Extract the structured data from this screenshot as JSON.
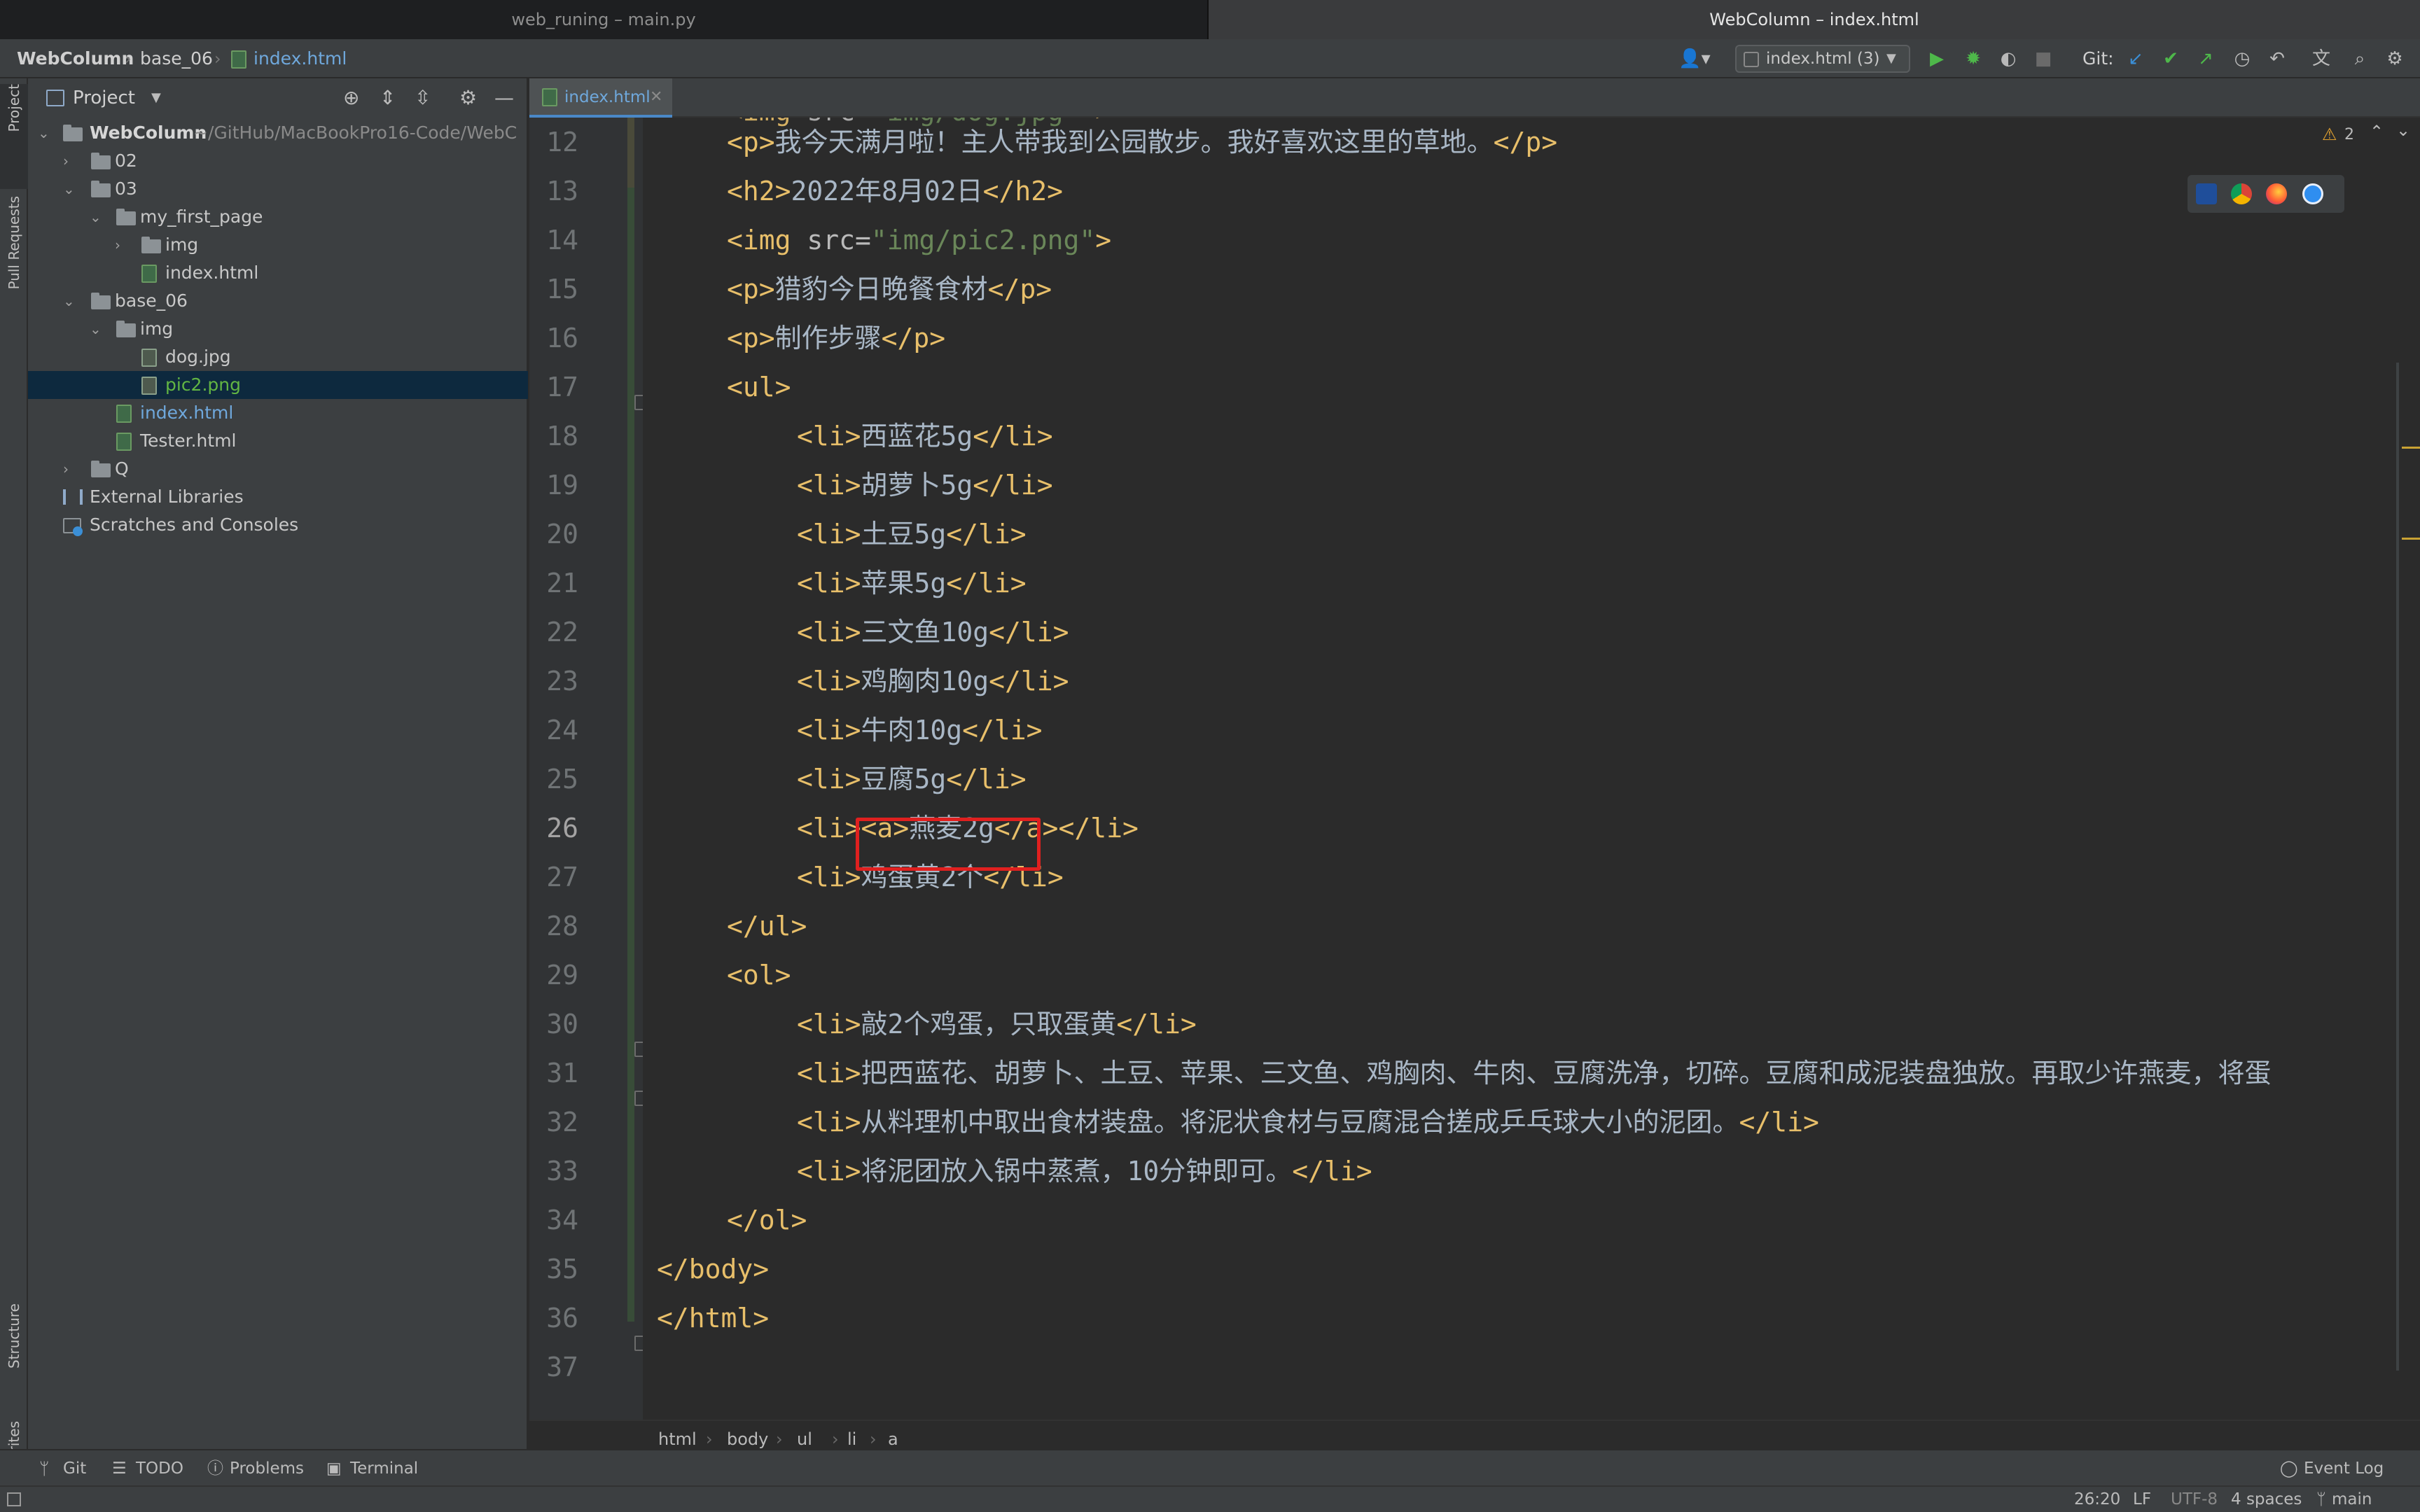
{
  "window": {
    "left_title": "web_runing – main.py",
    "right_title": "WebColumn – index.html"
  },
  "nav": {
    "crumbs": [
      "WebColumn",
      "base_06",
      "index.html"
    ],
    "run_config": "index.html (3)",
    "git_label": "Git:"
  },
  "left_strip": {
    "tabs": [
      "Project",
      "Pull Requests",
      "Structure",
      "Favorites"
    ]
  },
  "project": {
    "header": "Project",
    "tree": [
      {
        "label": "WebColumn",
        "suffix": "~/GitHub/MacBookPro16-Code/WebC",
        "type": "folder",
        "expanded": true
      },
      {
        "label": "02",
        "type": "folder",
        "expanded": false
      },
      {
        "label": "03",
        "type": "folder",
        "expanded": true
      },
      {
        "label": "my_first_page",
        "type": "folder",
        "expanded": true
      },
      {
        "label": "img",
        "type": "folder",
        "expanded": false
      },
      {
        "label": "index.html",
        "type": "file"
      },
      {
        "label": "base_06",
        "type": "folder",
        "expanded": true
      },
      {
        "label": "img",
        "type": "folder",
        "expanded": true
      },
      {
        "label": "dog.jpg",
        "type": "file"
      },
      {
        "label": "pic2.png",
        "type": "file",
        "selected": true
      },
      {
        "label": "index.html",
        "type": "file"
      },
      {
        "label": "Tester.html",
        "type": "file"
      },
      {
        "label": "Q",
        "type": "folder",
        "expanded": false
      },
      {
        "label": "External Libraries",
        "type": "lib"
      },
      {
        "label": "Scratches and Consoles",
        "type": "scratch"
      }
    ]
  },
  "editor": {
    "tab_label": "index.html",
    "warnings": "2",
    "lines": [
      {
        "n": "12",
        "indent": 1,
        "parts": [
          [
            "t",
            "<p>"
          ],
          [
            "txt",
            "我今天满月啦！主人带我到公园散步。我好喜欢这里的草地。"
          ],
          [
            "t",
            "</p>"
          ]
        ]
      },
      {
        "n": "13",
        "indent": 1,
        "parts": [
          [
            "t",
            "<h2>"
          ],
          [
            "txt",
            "2022年8月02日"
          ],
          [
            "t",
            "</h2>"
          ]
        ]
      },
      {
        "n": "14",
        "indent": 1,
        "parts": [
          [
            "t",
            "<img "
          ],
          [
            "an",
            "src="
          ],
          [
            "av",
            "\"img/pic2.png\""
          ],
          [
            "t",
            ">"
          ]
        ]
      },
      {
        "n": "15",
        "indent": 1,
        "parts": [
          [
            "t",
            "<p>"
          ],
          [
            "txt",
            "猎豹今日晚餐食材"
          ],
          [
            "t",
            "</p>"
          ]
        ]
      },
      {
        "n": "16",
        "indent": 1,
        "parts": [
          [
            "t",
            "<p>"
          ],
          [
            "txt",
            "制作步骤"
          ],
          [
            "t",
            "</p>"
          ]
        ]
      },
      {
        "n": "17",
        "indent": 1,
        "parts": [
          [
            "t",
            "<ul>"
          ]
        ]
      },
      {
        "n": "18",
        "indent": 2,
        "parts": [
          [
            "t",
            "<li>"
          ],
          [
            "txt",
            "西蓝花5g"
          ],
          [
            "t",
            "</li>"
          ]
        ]
      },
      {
        "n": "19",
        "indent": 2,
        "parts": [
          [
            "t",
            "<li>"
          ],
          [
            "txt",
            "胡萝卜5g"
          ],
          [
            "t",
            "</li>"
          ]
        ]
      },
      {
        "n": "20",
        "indent": 2,
        "parts": [
          [
            "t",
            "<li>"
          ],
          [
            "txt",
            "土豆5g"
          ],
          [
            "t",
            "</li>"
          ]
        ]
      },
      {
        "n": "21",
        "indent": 2,
        "parts": [
          [
            "t",
            "<li>"
          ],
          [
            "txt",
            "苹果5g"
          ],
          [
            "t",
            "</li>"
          ]
        ]
      },
      {
        "n": "22",
        "indent": 2,
        "parts": [
          [
            "t",
            "<li>"
          ],
          [
            "txt",
            "三文鱼10g"
          ],
          [
            "t",
            "</li>"
          ]
        ]
      },
      {
        "n": "23",
        "indent": 2,
        "parts": [
          [
            "t",
            "<li>"
          ],
          [
            "txt",
            "鸡胸肉10g"
          ],
          [
            "t",
            "</li>"
          ]
        ]
      },
      {
        "n": "24",
        "indent": 2,
        "parts": [
          [
            "t",
            "<li>"
          ],
          [
            "txt",
            "牛肉10g"
          ],
          [
            "t",
            "</li>"
          ]
        ]
      },
      {
        "n": "25",
        "indent": 2,
        "parts": [
          [
            "t",
            "<li>"
          ],
          [
            "txt",
            "豆腐5g"
          ],
          [
            "t",
            "</li>"
          ]
        ]
      },
      {
        "n": "26",
        "indent": 2,
        "parts": [
          [
            "t",
            "<li>"
          ],
          [
            "t",
            "<a>"
          ],
          [
            "txt",
            "燕麦2g"
          ],
          [
            "t",
            "</a>"
          ],
          [
            "t",
            "</li>"
          ]
        ]
      },
      {
        "n": "27",
        "indent": 2,
        "parts": [
          [
            "t",
            "<li>"
          ],
          [
            "txt",
            "鸡蛋黄2个"
          ],
          [
            "t",
            "</li>"
          ]
        ]
      },
      {
        "n": "28",
        "indent": 1,
        "parts": [
          [
            "t",
            "</ul>"
          ]
        ]
      },
      {
        "n": "29",
        "indent": 1,
        "parts": [
          [
            "t",
            "<ol>"
          ]
        ]
      },
      {
        "n": "30",
        "indent": 2,
        "parts": [
          [
            "t",
            "<li>"
          ],
          [
            "txt",
            "敲2个鸡蛋，只取蛋黄"
          ],
          [
            "t",
            "</li>"
          ]
        ]
      },
      {
        "n": "31",
        "indent": 2,
        "parts": [
          [
            "t",
            "<li>"
          ],
          [
            "txt",
            "把西蓝花、胡萝卜、土豆、苹果、三文鱼、鸡胸肉、牛肉、豆腐洗净，切碎。豆腐和成泥装盘独放。再取少许燕麦，将蛋"
          ]
        ]
      },
      {
        "n": "32",
        "indent": 2,
        "parts": [
          [
            "t",
            "<li>"
          ],
          [
            "txt",
            "从料理机中取出食材装盘。将泥状食材与豆腐混合搓成乒乓球大小的泥团。"
          ],
          [
            "t",
            "</li>"
          ]
        ]
      },
      {
        "n": "33",
        "indent": 2,
        "parts": [
          [
            "t",
            "<li>"
          ],
          [
            "txt",
            "将泥团放入锅中蒸煮，10分钟即可。"
          ],
          [
            "t",
            "</li>"
          ]
        ]
      },
      {
        "n": "34",
        "indent": 1,
        "parts": [
          [
            "t",
            "</ol>"
          ]
        ]
      },
      {
        "n": "35",
        "indent": 0,
        "parts": [
          [
            "t",
            "</body>"
          ]
        ]
      },
      {
        "n": "36",
        "indent": 0,
        "parts": [
          [
            "t",
            "</html>"
          ]
        ]
      },
      {
        "n": "37",
        "indent": 0,
        "parts": []
      }
    ]
  },
  "breadcrumbs": [
    "html",
    "body",
    "ul",
    "li",
    "a"
  ],
  "toolwindows": [
    "Git",
    "TODO",
    "Problems",
    "Terminal"
  ],
  "event_log": "Event Log",
  "status": {
    "position": "26:20",
    "line_sep": "LF",
    "encoding": "UTF-8",
    "indent": "4 spaces",
    "branch": "main"
  },
  "colors": {
    "tag": "#e8bf6a",
    "attr_value": "#6a8759",
    "highlight_box": "#e0201f",
    "accent": "#4a88c7"
  }
}
